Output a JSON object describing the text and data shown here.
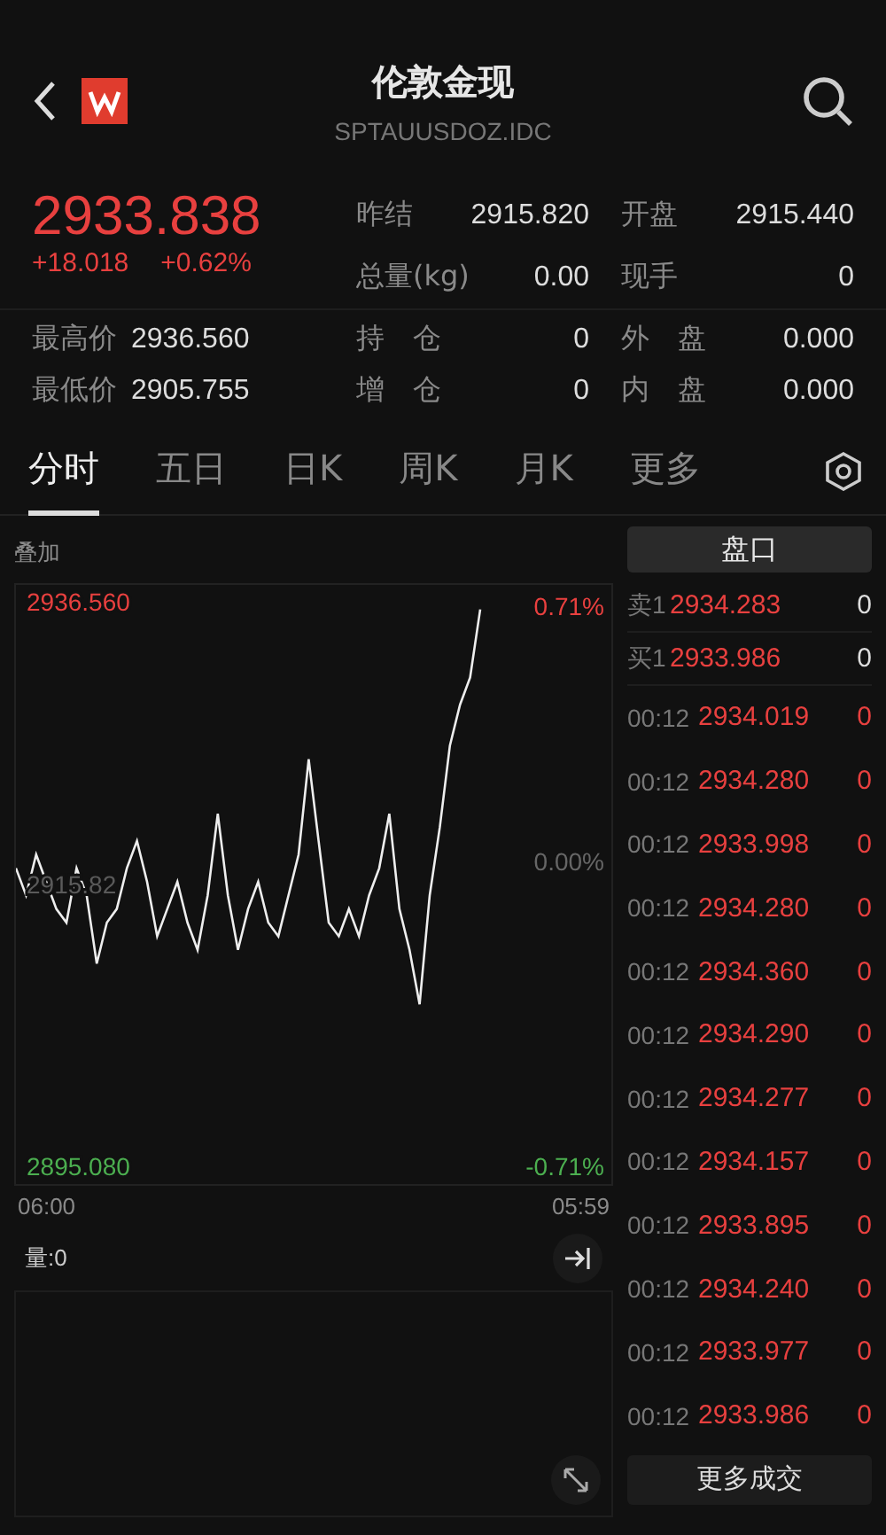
{
  "header": {
    "title": "伦敦金现",
    "code": "SPTAUUSDOZ.IDC"
  },
  "quote": {
    "price": "2933.838",
    "change": "+18.018",
    "change_pct": "+0.62%"
  },
  "stats": [
    {
      "label": "昨结",
      "value": "2915.820"
    },
    {
      "label": "开盘",
      "value": "2915.440"
    },
    {
      "label": "总量(kg)",
      "value": "0.00"
    },
    {
      "label": "现手",
      "value": "0"
    }
  ],
  "stats_lower": [
    {
      "label": "最高价",
      "value": "2936.560"
    },
    {
      "label": "持　仓",
      "value": "0"
    },
    {
      "label": "外　盘",
      "value": "0.000"
    },
    {
      "label": "最低价",
      "value": "2905.755"
    },
    {
      "label": "增　仓",
      "value": "0"
    },
    {
      "label": "内　盘",
      "value": "0.000"
    }
  ],
  "tabs": [
    {
      "label": "分时",
      "selected": true
    },
    {
      "label": "五日",
      "selected": false
    },
    {
      "label": "日K",
      "selected": false
    },
    {
      "label": "周K",
      "selected": false
    },
    {
      "label": "月K",
      "selected": false
    },
    {
      "label": "更多",
      "selected": false
    }
  ],
  "chart": {
    "chart_data": {
      "type": "line",
      "ylim": [
        2893.8,
        2937.8
      ],
      "yticks": [
        {
          "value": 2936.56,
          "label": "2936.560"
        },
        {
          "value": 2915.82,
          "label": "2915.82"
        },
        {
          "value": 2895.08,
          "label": "2895.080"
        }
      ],
      "categories": [
        null,
        null,
        null,
        null,
        null,
        null,
        null,
        null,
        null,
        null,
        null,
        null,
        null,
        null,
        null,
        null,
        null,
        null,
        null,
        null,
        null,
        null,
        null,
        null,
        null,
        null,
        null,
        null,
        null,
        null,
        null,
        null,
        null,
        null,
        null,
        null,
        null,
        null,
        null,
        null,
        null,
        null,
        null,
        null,
        null,
        null,
        null,
        null,
        null,
        null,
        null,
        null,
        null,
        null,
        null,
        null,
        null,
        null,
        null,
        null
      ],
      "series": [
        {
          "color": "#eeeeee",
          "values": [
            2917,
            2915,
            2918,
            2916,
            2914,
            2913,
            2917,
            2915,
            2910,
            2913,
            2914,
            2917,
            2919,
            2916,
            2912,
            2914,
            2916,
            2913,
            2911,
            2915,
            2921,
            2915,
            2911,
            2914,
            2916,
            2913,
            2912,
            2915,
            2918,
            2925,
            2919,
            2913,
            2912,
            2914,
            2912,
            2915,
            2917,
            2921,
            2914,
            2911,
            2907,
            2915,
            2920,
            2926,
            2929,
            2931,
            2936,
            null,
            null,
            null,
            null,
            null,
            null,
            null,
            null,
            null,
            null,
            null,
            null,
            null
          ]
        }
      ]
    },
    "overlay_label": "叠加",
    "high_pct": "0.71%",
    "mid_pct": "0.00%",
    "low_pct": "-0.71%",
    "time_start": "06:00",
    "time_end": "05:59",
    "volume_label": "量:0"
  },
  "order_book": {
    "title": "盘口",
    "rows": [
      {
        "kind": "quote",
        "label": "卖1",
        "price": "2934.283",
        "volume": "0"
      },
      {
        "kind": "quote",
        "label": "买1",
        "price": "2933.986",
        "volume": "0"
      },
      {
        "kind": "trade",
        "label": "00:12",
        "price": "2934.019",
        "volume": "0"
      },
      {
        "kind": "trade",
        "label": "00:12",
        "price": "2934.280",
        "volume": "0"
      },
      {
        "kind": "trade",
        "label": "00:12",
        "price": "2933.998",
        "volume": "0"
      },
      {
        "kind": "trade",
        "label": "00:12",
        "price": "2934.280",
        "volume": "0"
      },
      {
        "kind": "trade",
        "label": "00:12",
        "price": "2934.360",
        "volume": "0"
      },
      {
        "kind": "trade",
        "label": "00:12",
        "price": "2934.290",
        "volume": "0"
      },
      {
        "kind": "trade",
        "label": "00:12",
        "price": "2934.277",
        "volume": "0"
      },
      {
        "kind": "trade",
        "label": "00:12",
        "price": "2934.157",
        "volume": "0"
      },
      {
        "kind": "trade",
        "label": "00:12",
        "price": "2933.895",
        "volume": "0"
      },
      {
        "kind": "trade",
        "label": "00:12",
        "price": "2934.240",
        "volume": "0"
      },
      {
        "kind": "trade",
        "label": "00:12",
        "price": "2933.977",
        "volume": "0"
      },
      {
        "kind": "trade",
        "label": "00:12",
        "price": "2933.986",
        "volume": "0"
      }
    ],
    "more_button": "更多成交"
  }
}
